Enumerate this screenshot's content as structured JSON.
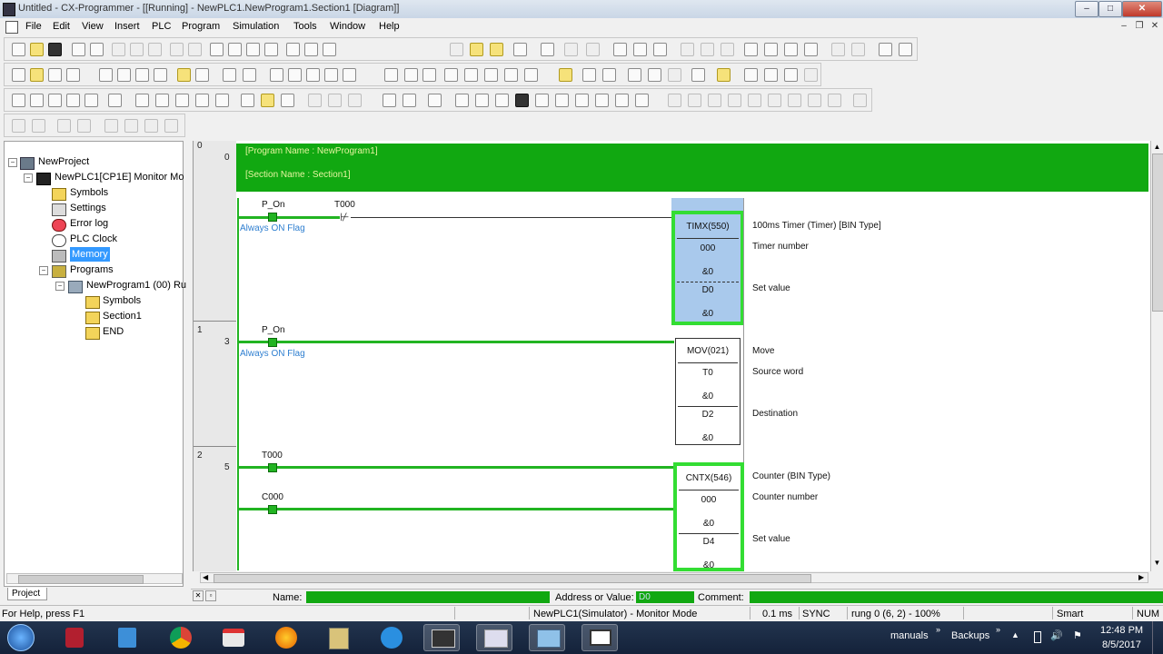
{
  "window": {
    "title": "Untitled - CX-Programmer - [[Running] - NewPLC1.NewProgram1.Section1 [Diagram]]"
  },
  "menu": [
    "File",
    "Edit",
    "View",
    "Insert",
    "PLC",
    "Program",
    "Simulation",
    "Tools",
    "Window",
    "Help"
  ],
  "project_tree": {
    "root": "NewProject",
    "plc": "NewPLC1[CP1E] Monitor Mo",
    "plc_children": [
      "Symbols",
      "Settings",
      "Error log",
      "PLC Clock",
      "Memory",
      "Programs"
    ],
    "program": "NewProgram1 (00) Ru",
    "program_children": [
      "Symbols",
      "Section1",
      "END"
    ],
    "selected": "Memory",
    "tab": "Project"
  },
  "diagram": {
    "header": {
      "program_name": "[Program Name : NewProgram1]",
      "section_name": "[Section Name : Section1]"
    },
    "rungs": [
      {
        "rung": "0",
        "step": "0",
        "contacts": [
          {
            "op": "P_On",
            "comment": "Always ON Flag",
            "state": "on"
          },
          {
            "op": "T000",
            "comment": "",
            "state": "off"
          }
        ],
        "instruction": {
          "name": "TIMX(550)",
          "description": "100ms Timer (Timer) [BIN Type]",
          "operands": [
            {
              "value": "000",
              "current": "&0",
              "label": "Timer number"
            },
            {
              "value": "D0",
              "current": "&0",
              "label": "Set value"
            }
          ]
        }
      },
      {
        "rung": "1",
        "step": "3",
        "contacts": [
          {
            "op": "P_On",
            "comment": "Always ON Flag",
            "state": "on"
          }
        ],
        "instruction": {
          "name": "MOV(021)",
          "description": "Move",
          "operands": [
            {
              "value": "T0",
              "current": "&0",
              "label": "Source word"
            },
            {
              "value": "D2",
              "current": "&0",
              "label": "Destination"
            }
          ]
        }
      },
      {
        "rung": "2",
        "step": "5",
        "contacts": [
          {
            "op": "T000",
            "comment": "",
            "state": "on"
          },
          {
            "op": "C000",
            "comment": "",
            "state": "on"
          }
        ],
        "instruction": {
          "name": "CNTX(546)",
          "description": "Counter (BIN Type)",
          "operands": [
            {
              "value": "000",
              "current": "&0",
              "label": "Counter number"
            },
            {
              "value": "D4",
              "current": "&0",
              "label": "Set value"
            }
          ]
        }
      }
    ]
  },
  "bottom_bar": {
    "name_label": "Name:",
    "address_label": "Address or Value:",
    "address_value": "D0",
    "comment_label": "Comment:"
  },
  "status": {
    "help": "For Help, press F1",
    "mode": "NewPLC1(Simulator) - Monitor Mode",
    "cycle": "0.1 ms",
    "sync": "SYNC",
    "position": "rung 0 (6, 2)  - 100%",
    "smart": "Smart",
    "num": "NUM"
  },
  "taskbar": {
    "tray_items": [
      "manuals",
      "Backups"
    ],
    "time": "12:48 PM",
    "date": "8/5/2017"
  },
  "colors": {
    "energized": "#22b422",
    "header_band": "#11a811",
    "selection": "#a9c9ec",
    "comment_blue": "#2f7fd0"
  }
}
